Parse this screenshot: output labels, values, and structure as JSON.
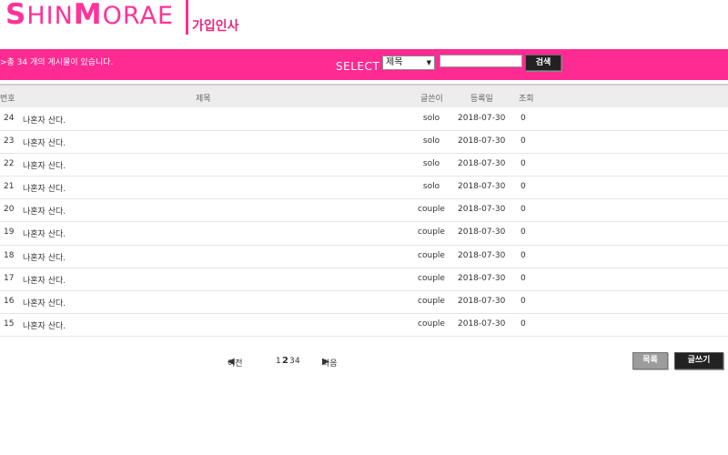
{
  "header": {
    "logo_big_s": "S",
    "logo_hin": "HIN",
    "logo_big_m": "M",
    "logo_orae": "ORAE",
    "page_title": "가입인사"
  },
  "toolbar": {
    "total_count_text": ">총 34 개의 게시물이 있습니다.",
    "select_label": "SELECT",
    "select_value": "제목",
    "search_value": "",
    "search_button": "검색"
  },
  "table": {
    "headers": {
      "no": "번호",
      "subject": "제목",
      "writer": "글쓴이",
      "date": "등록일",
      "views": "조회"
    },
    "rows": [
      {
        "no": "24",
        "subject": "나혼자 산다.",
        "writer": "solo",
        "date": "2018-07-30",
        "views": "0"
      },
      {
        "no": "23",
        "subject": "나혼자 산다.",
        "writer": "solo",
        "date": "2018-07-30",
        "views": "0"
      },
      {
        "no": "22",
        "subject": "나혼자 산다.",
        "writer": "solo",
        "date": "2018-07-30",
        "views": "0"
      },
      {
        "no": "21",
        "subject": "나혼자 산다.",
        "writer": "solo",
        "date": "2018-07-30",
        "views": "0"
      },
      {
        "no": "20",
        "subject": "나혼자 산다.",
        "writer": "couple",
        "date": "2018-07-30",
        "views": "0"
      },
      {
        "no": "19",
        "subject": "나혼자 산다.",
        "writer": "couple",
        "date": "2018-07-30",
        "views": "0"
      },
      {
        "no": "18",
        "subject": "나혼자 산다.",
        "writer": "couple",
        "date": "2018-07-30",
        "views": "0"
      },
      {
        "no": "17",
        "subject": "나혼자 산다.",
        "writer": "couple",
        "date": "2018-07-30",
        "views": "0"
      },
      {
        "no": "16",
        "subject": "나혼자 산다.",
        "writer": "couple",
        "date": "2018-07-30",
        "views": "0"
      },
      {
        "no": "15",
        "subject": "나혼자 산다.",
        "writer": "couple",
        "date": "2018-07-30",
        "views": "0"
      }
    ]
  },
  "pagination": {
    "prev_label": "이전",
    "pages": [
      "1",
      "2",
      "3",
      "4"
    ],
    "current_page": "2",
    "next_label": "다음"
  },
  "actions": {
    "list_button": "목록",
    "write_button": "글쓰기"
  },
  "colors": {
    "brand_pink": "#ff2a92",
    "button_dark": "#222222",
    "button_gray": "#9c9c9c"
  }
}
